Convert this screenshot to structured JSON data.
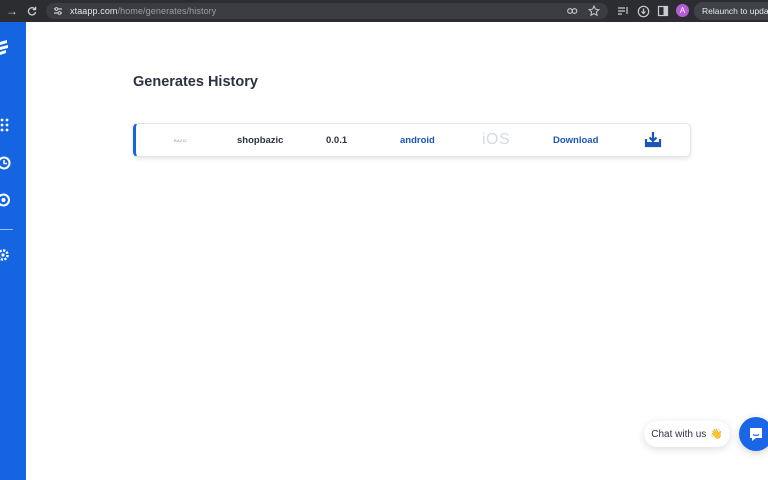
{
  "browser": {
    "url_domain": "xtaapp.com",
    "url_path": "/home/generates/history",
    "avatar_letter": "A",
    "relaunch_label": "Relaunch to update"
  },
  "page": {
    "title": "Generates History"
  },
  "history": {
    "rows": [
      {
        "logo_text": "BAZIC",
        "app_name": "shopbazic",
        "version": "0.0.1",
        "platform_android": "android",
        "platform_ios": "iOS",
        "download_label": "Download"
      }
    ]
  },
  "chat": {
    "label": "Chat with us",
    "emoji": "👋"
  },
  "colors": {
    "brand": "#1565e3",
    "link": "#1a56b8",
    "ios_disabled": "#d4dbe6"
  }
}
